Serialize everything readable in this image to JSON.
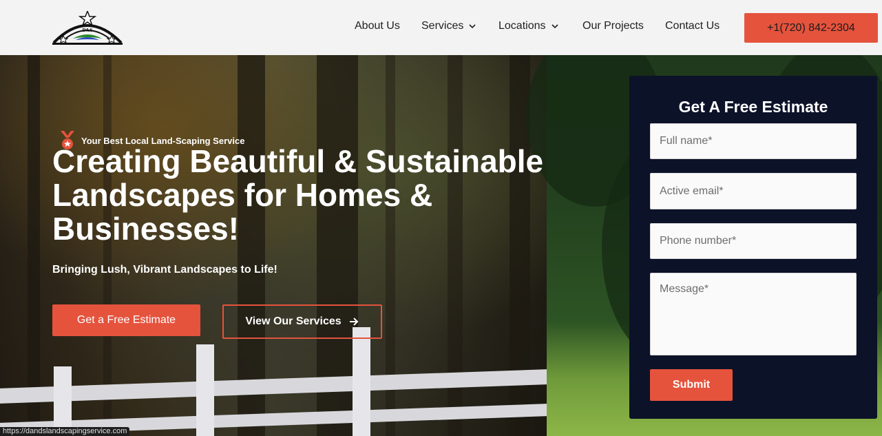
{
  "header": {
    "logo_alt": "D&S",
    "nav": [
      {
        "label": "About Us",
        "has_dropdown": false
      },
      {
        "label": "Services",
        "has_dropdown": true
      },
      {
        "label": "Locations",
        "has_dropdown": true
      },
      {
        "label": "Our Projects",
        "has_dropdown": false
      },
      {
        "label": "Contact Us",
        "has_dropdown": false
      }
    ],
    "phone": "+1(720) 842-2304"
  },
  "hero": {
    "tagline": "Your Best Local Land-Scaping Service",
    "headline": "Creating Beautiful & Sustainable Landscapes for Homes & Businesses!",
    "subhead": "Bringing Lush, Vibrant Landscapes to Life!",
    "primary_button": "Get a Free Estimate",
    "secondary_button": "View Our Services"
  },
  "form": {
    "title": "Get A Free Estimate",
    "full_name_placeholder": "Full name*",
    "email_placeholder": "Active email*",
    "phone_placeholder": "Phone number*",
    "message_placeholder": "Message*",
    "submit_label": "Submit"
  },
  "status_bar": {
    "url": "https://dandslandscapingservice.com"
  },
  "colors": {
    "accent": "#e5533d",
    "form_bg": "#0c1228",
    "header_bg": "#f3f3f3"
  }
}
